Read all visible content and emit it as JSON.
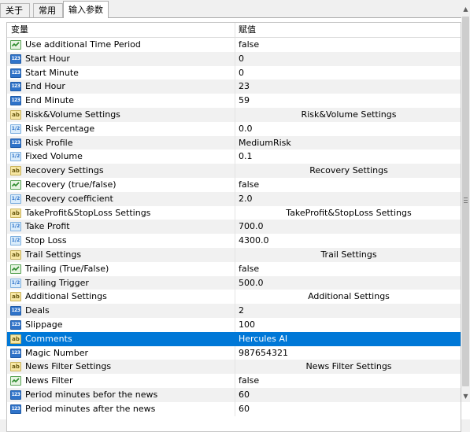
{
  "tabs": [
    {
      "label": "关于"
    },
    {
      "label": "常用"
    },
    {
      "label": "输入参数"
    }
  ],
  "header": {
    "variable": "变量",
    "value": "赋值"
  },
  "icons": {
    "int": "123",
    "dbl": "1/2",
    "str": "ab"
  },
  "rows": [
    {
      "type": "bool",
      "name": "Use additional Time Period",
      "value": "false"
    },
    {
      "type": "int",
      "name": "Start Hour",
      "value": "0"
    },
    {
      "type": "int",
      "name": "Start Minute",
      "value": "0"
    },
    {
      "type": "int",
      "name": "End Hour",
      "value": "23"
    },
    {
      "type": "int",
      "name": "End Minute",
      "value": "59"
    },
    {
      "type": "str",
      "name": "Risk&Volume Settings",
      "value": "Risk&Volume Settings",
      "section": true
    },
    {
      "type": "dbl",
      "name": "Risk Percentage",
      "value": "0.0"
    },
    {
      "type": "int",
      "name": "Risk Profile",
      "value": "MediumRisk"
    },
    {
      "type": "dbl",
      "name": "Fixed Volume",
      "value": "0.1"
    },
    {
      "type": "str",
      "name": "Recovery Settings",
      "value": "Recovery Settings",
      "section": true
    },
    {
      "type": "bool",
      "name": "Recovery (true/false)",
      "value": "false"
    },
    {
      "type": "dbl",
      "name": "Recovery coefficient",
      "value": "2.0"
    },
    {
      "type": "str",
      "name": "TakeProfit&StopLoss Settings",
      "value": "TakeProfit&StopLoss Settings",
      "section": true
    },
    {
      "type": "dbl",
      "name": "Take Profit",
      "value": "700.0"
    },
    {
      "type": "dbl",
      "name": "Stop Loss",
      "value": "4300.0"
    },
    {
      "type": "str",
      "name": "Trail Settings",
      "value": "Trail Settings",
      "section": true
    },
    {
      "type": "bool",
      "name": "Trailing (True/False)",
      "value": "false"
    },
    {
      "type": "dbl",
      "name": "Trailing Trigger",
      "value": "500.0"
    },
    {
      "type": "str",
      "name": "Additional Settings",
      "value": "Additional Settings",
      "section": true
    },
    {
      "type": "int",
      "name": "Deals",
      "value": "2"
    },
    {
      "type": "int",
      "name": "Slippage",
      "value": "100"
    },
    {
      "type": "str",
      "name": "Comments",
      "value": "Hercules AI",
      "selected": true
    },
    {
      "type": "int",
      "name": "Magic Number",
      "value": "987654321"
    },
    {
      "type": "str",
      "name": "News Filter Settings",
      "value": "News Filter Settings",
      "section": true
    },
    {
      "type": "bool",
      "name": "News Filter",
      "value": "false"
    },
    {
      "type": "int",
      "name": "Period minutes befor the news",
      "value": "60"
    },
    {
      "type": "int",
      "name": "Period minutes after the news",
      "value": "60"
    }
  ],
  "colors": {
    "selection": "#0078d7",
    "int_icon": "#2f73c9",
    "bool_icon": "#5aa356",
    "str_icon": "#f7e7a4"
  }
}
